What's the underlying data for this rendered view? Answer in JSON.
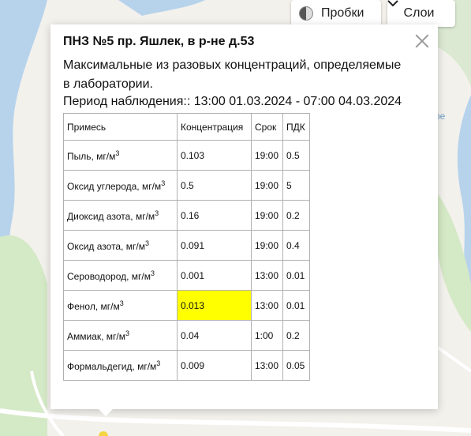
{
  "controls": {
    "traffic_label": "Пробки",
    "layers_label": "Слои"
  },
  "map": {
    "label_fragment": "ре"
  },
  "balloon": {
    "title": "ПНЗ №5 пр. Яшлек, в р-не д.53",
    "description": "Максимальные из разовых концентраций, определяемые в лаборатории.",
    "period": "Период наблюдения:: 13:00 01.03.2024 - 07:00 04.03.2024",
    "table": {
      "headers": [
        "Примесь",
        "Концентрация",
        "Срок",
        "ПДК"
      ],
      "unit_superscript": "3",
      "rows": [
        {
          "name": "Пыль, мг/м",
          "value": "0.103",
          "time": "19:00",
          "pdk": "0.5"
        },
        {
          "name": "Оксид углерода, мг/м",
          "value": "0.5",
          "time": "19:00",
          "pdk": "5"
        },
        {
          "name": "Диоксид азота, мг/м",
          "value": "0.16",
          "time": "19:00",
          "pdk": "0.2"
        },
        {
          "name": "Оксид азота, мг/м",
          "value": "0.091",
          "time": "19:00",
          "pdk": "0.4"
        },
        {
          "name": "Сероводород, мг/м",
          "value": "0.001",
          "time": "13:00",
          "pdk": "0.01"
        },
        {
          "name": "Фенол, мг/м",
          "value": "0.013",
          "time": "13:00",
          "pdk": "0.01",
          "highlight": true
        },
        {
          "name": "Аммиак, мг/м",
          "value": "0.04",
          "time": "1:00",
          "pdk": "0.2"
        },
        {
          "name": "Формальдегид, мг/м",
          "value": "0.009",
          "time": "13:00",
          "pdk": "0.05"
        }
      ]
    }
  },
  "colors": {
    "highlight": "#ffff00",
    "water": "#b7d3ec",
    "park": "#d4e9c6",
    "land": "#f3f1ec"
  }
}
